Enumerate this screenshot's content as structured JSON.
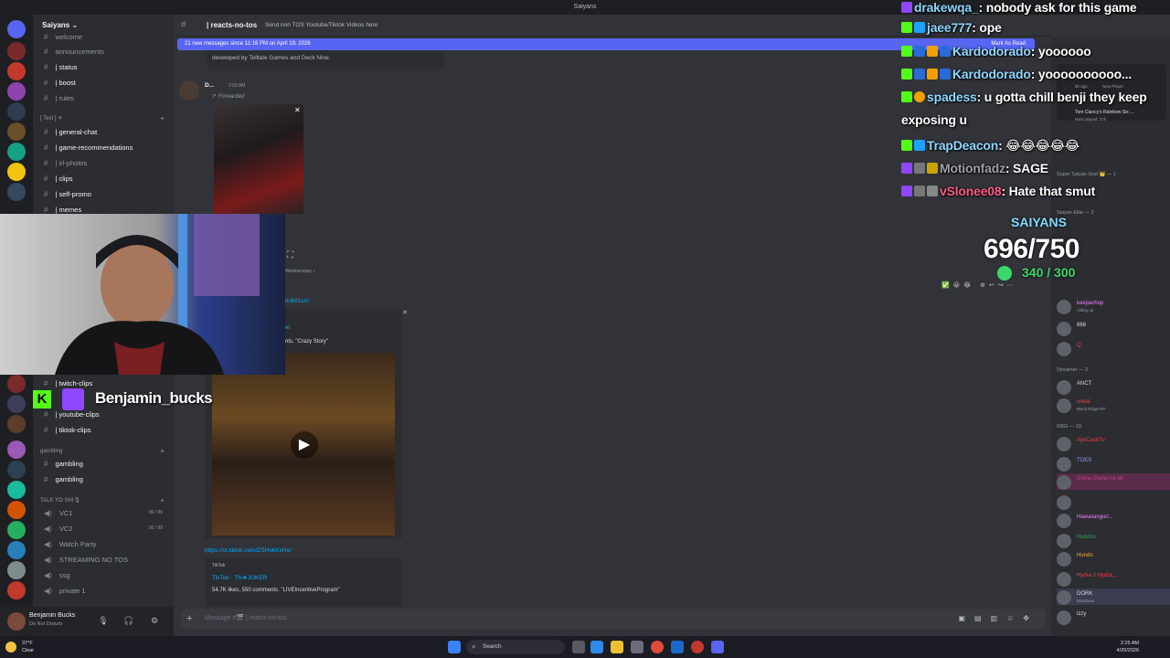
{
  "window": {
    "title": "Saiyans"
  },
  "sidebar": {
    "guild_name": "Saiyans ⌄",
    "channels_top": [
      {
        "name": "welcome"
      },
      {
        "name": "announcements"
      },
      {
        "name": "| status"
      },
      {
        "name": "| boost"
      },
      {
        "name": "| rules"
      }
    ],
    "text_category": "[ Text ] ✈",
    "channels_text": [
      {
        "name": "| general-chat"
      },
      {
        "name": "| game-recommendations"
      },
      {
        "name": "| irl-photos"
      },
      {
        "name": "| clips"
      },
      {
        "name": "| self-promo"
      },
      {
        "name": "| memes"
      }
    ],
    "channels_lower": [
      {
        "name": "| twitch-clips"
      },
      {
        "name": "| youtube-clips"
      },
      {
        "name": "| tiktok-clips"
      }
    ],
    "gambling_category": "gambling",
    "channels_gambling": [
      {
        "name": "gambling"
      },
      {
        "name": "gambling"
      }
    ],
    "voice_category": "TALK YO SHI🎙",
    "voice_channels": [
      {
        "name": "VC1",
        "count": "00 / 99"
      },
      {
        "name": "VC2",
        "count": "00 / 99"
      },
      {
        "name": "Watch Party",
        "count": ""
      },
      {
        "name": "STREAMING NO TOS",
        "count": ""
      },
      {
        "name": "ssg",
        "count": ""
      },
      {
        "name": "private 1",
        "count": ""
      }
    ]
  },
  "user": {
    "name": "Benjamin Bucks",
    "status": "Do Not Disturb"
  },
  "header": {
    "channel": "| reacts-no-tos",
    "topic": "Send non TOS Youtube/Tiktok Videos here"
  },
  "new_messages": {
    "text": "21 new messages since 11:16 PM on April 19, 2026",
    "mark_read": "Mark As Read"
  },
  "messages": {
    "dev_line": "developed by Telltale Games and Deck Nine.",
    "author": "D...",
    "time": "2:03 AM",
    "forwarded": "↱ Forwarded",
    "wednesday": "Wednesday ›",
    "partial_link": "ttoB61vA/",
    "crazy_story": "nts. \"Crazy Story\"",
    "embed2_title": "et",
    "tiktok_url": "https://vt.tiktok.com/ZSHokKxHx/",
    "tiktok_label": "TikTok",
    "tiktok_author": "TikTok · TN★JOKER",
    "tiktok_stats": "54.7K likes, 550 comments. \"LIVEIncentiveProgram\""
  },
  "composer": {
    "placeholder": "Message #🎬 | reacts-no-tos"
  },
  "members": {
    "top_items": [
      {
        "name": "Tom Clancy's Rainbow Six ...",
        "sub": "Most played: 27h"
      },
      {
        "name": "New Player",
        "sub": "8h ago"
      }
    ],
    "groups": [
      {
        "title": "Super Saiyan God 👑 — 1"
      },
      {
        "title": "Saiyan Elite — 2"
      },
      {
        "title": "Streamer — 2"
      },
      {
        "title": "GBG — 19"
      }
    ],
    "list": [
      {
        "name": "keepachop",
        "sub": "rolling up",
        "color": "#f47fff"
      },
      {
        "name": "666",
        "sub": "",
        "color": "#dbdee1"
      },
      {
        "name": "Q",
        "sub": "",
        "color": "#f23f43"
      },
      {
        "name": "ANCT",
        "sub": "",
        "color": "#dbdee1"
      },
      {
        "name": "oneal",
        "sub": "Black Ridge RP",
        "color": "#f23f43"
      },
      {
        "name": "AyeCashTv",
        "sub": "",
        "color": "#f23f43"
      },
      {
        "name": "TOES",
        "sub": "",
        "color": "#949cf7"
      },
      {
        "name": "Gomu Gomu no Mi",
        "sub": "",
        "color": "#c34a8a"
      },
      {
        "name": "",
        "sub": "",
        "color": "#dbdee1"
      },
      {
        "name": "Hawaiianguri...",
        "sub": "",
        "color": "#f47fff"
      },
      {
        "name": "Huncho",
        "sub": "",
        "color": "#3ba55c"
      },
      {
        "name": "Hundo",
        "sub": "",
        "color": "#f0b232"
      },
      {
        "name": "Hydra // Hydra...",
        "sub": "",
        "color": "#f23f43"
      },
      {
        "name": "DORK",
        "sub": "blackbear",
        "color": "#dbdee1"
      },
      {
        "name": "izzy",
        "sub": "",
        "color": "#dbdee1"
      }
    ]
  },
  "stream_chat": [
    {
      "user": "drakewqa_",
      "text": ": nobody ask for this game"
    },
    {
      "user": "jaee777",
      "text": ": ope"
    },
    {
      "user": "Kardodorado",
      "text": ": yoooooo"
    },
    {
      "user": "Kardodorado",
      "text": ": yoooooooooo..."
    },
    {
      "user": "spadess",
      "text": ": u gotta chill benji they keep"
    },
    {
      "user": "",
      "text": "exposing u"
    },
    {
      "user": "TrapDeacon",
      "text": ": 😂😂😂😂😂"
    },
    {
      "user": "Motionfadz",
      "text": ": SAGE"
    },
    {
      "user": "vSlonee08",
      "text": ": Hate that smut"
    }
  ],
  "sub_goal": {
    "title": "SAIYANS",
    "count": "696/750",
    "sub": "340 / 300"
  },
  "streamer_tag": {
    "name": "Benjamin_bucks"
  },
  "taskbar": {
    "weather_temp": "37°F",
    "weather_desc": "Clear",
    "search": "Search",
    "time": "2:25 AM",
    "date": "4/20/2026"
  }
}
